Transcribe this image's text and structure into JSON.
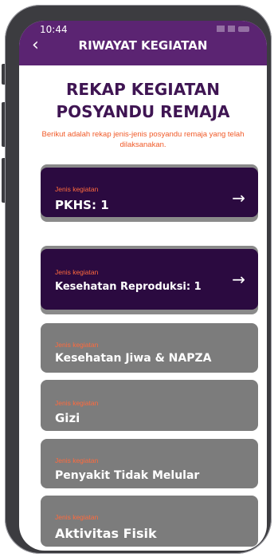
{
  "status_bar": {
    "time": "10:44"
  },
  "appbar": {
    "title": "RIWAYAT KEGIATAN",
    "back_icon": "chevron-left-icon"
  },
  "heading": {
    "line1": "REKAP KEGIATAN",
    "line2": "POSYANDU REMAJA"
  },
  "subtitle": "Berikut adalah rekap jenis-jenis posyandu remaja yang telah dilaksanakan.",
  "colors": {
    "primary": "#5b2472",
    "card_active": "#2b0a40",
    "card_inactive": "#7c7c7c",
    "accent": "#f05a28"
  },
  "cards": [
    {
      "kicker": "Jenis kegiatan",
      "name": "PKHS: 1",
      "active": true
    },
    {
      "kicker": "Jenis kegiatan",
      "name": "Kesehatan Reproduksi: 1",
      "active": true
    },
    {
      "kicker": "Jenis kegiatan",
      "name": "Kesehatan Jiwa & NAPZA",
      "active": false
    },
    {
      "kicker": "Jenis kegiatan",
      "name": "Gizi",
      "active": false
    },
    {
      "kicker": "Jenis kegiatan",
      "name": "Penyakit Tidak Melular",
      "active": false
    },
    {
      "kicker": "Jenis kegiatan",
      "name": "Aktivitas Fisik",
      "active": false
    }
  ]
}
